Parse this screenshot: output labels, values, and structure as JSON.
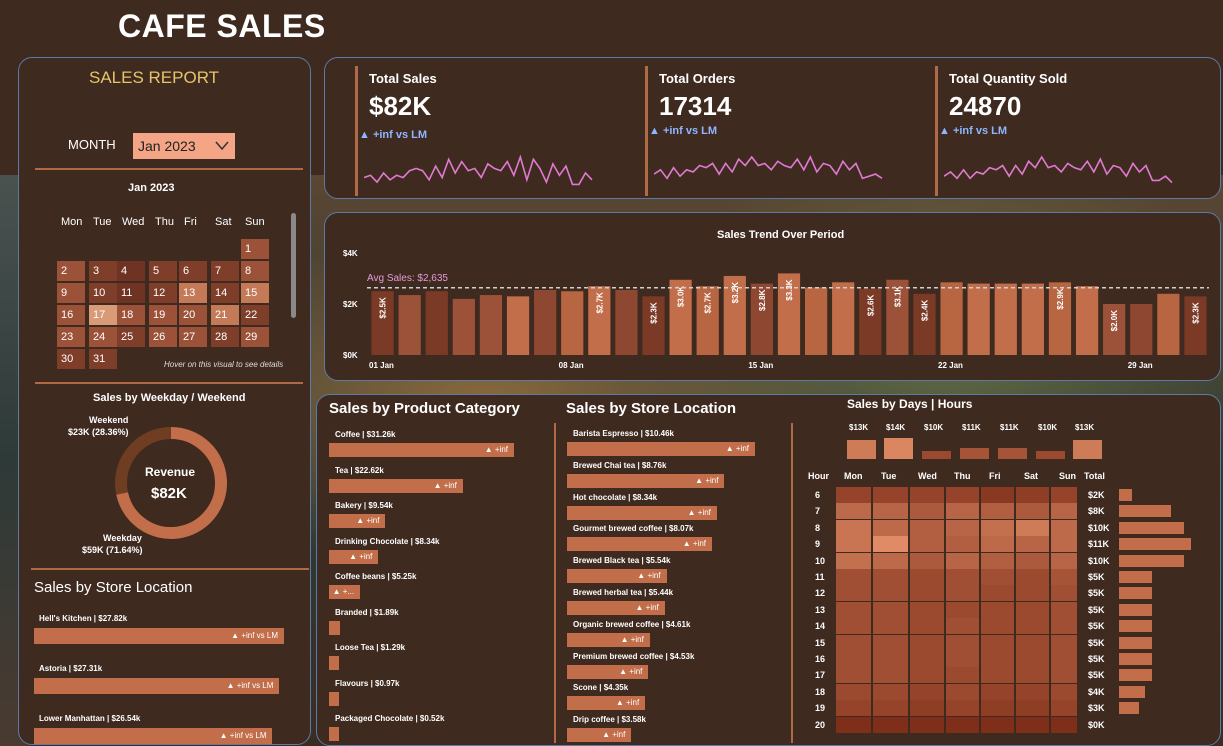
{
  "title": "CAFE SALES",
  "report": {
    "heading": "SALES REPORT",
    "month_label": "MONTH",
    "month_value": "Jan 2023",
    "calendar": {
      "title": "Jan 2023",
      "weekdays": [
        "Mon",
        "Tue",
        "Wed",
        "Thu",
        "Fri",
        "Sat",
        "Sun"
      ],
      "hint": "Hover on this visual to see details",
      "days": [
        {
          "d": "1",
          "col": 6,
          "row": 0,
          "c": "#9c5238"
        },
        {
          "d": "2",
          "col": 0,
          "row": 1,
          "c": "#9c5238"
        },
        {
          "d": "3",
          "col": 1,
          "row": 1,
          "c": "#7e3e29"
        },
        {
          "d": "4",
          "col": 2,
          "row": 1,
          "c": "#6e3322"
        },
        {
          "d": "5",
          "col": 3,
          "row": 1,
          "c": "#7e3e29"
        },
        {
          "d": "6",
          "col": 4,
          "row": 1,
          "c": "#7e3e29"
        },
        {
          "d": "7",
          "col": 5,
          "row": 1,
          "c": "#7e3e29"
        },
        {
          "d": "8",
          "col": 6,
          "row": 1,
          "c": "#9c5238"
        },
        {
          "d": "9",
          "col": 0,
          "row": 2,
          "c": "#9c5238"
        },
        {
          "d": "10",
          "col": 1,
          "row": 2,
          "c": "#7e3e29"
        },
        {
          "d": "11",
          "col": 2,
          "row": 2,
          "c": "#6e3322"
        },
        {
          "d": "12",
          "col": 3,
          "row": 2,
          "c": "#7e3e29"
        },
        {
          "d": "13",
          "col": 4,
          "row": 2,
          "c": "#c47a57"
        },
        {
          "d": "14",
          "col": 5,
          "row": 2,
          "c": "#7e3e29"
        },
        {
          "d": "15",
          "col": 6,
          "row": 2,
          "c": "#c47a57"
        },
        {
          "d": "16",
          "col": 0,
          "row": 3,
          "c": "#9c5238"
        },
        {
          "d": "17",
          "col": 1,
          "row": 3,
          "c": "#d99a78"
        },
        {
          "d": "18",
          "col": 2,
          "row": 3,
          "c": "#9c5238"
        },
        {
          "d": "19",
          "col": 3,
          "row": 3,
          "c": "#9c5238"
        },
        {
          "d": "20",
          "col": 4,
          "row": 3,
          "c": "#9c5238"
        },
        {
          "d": "21",
          "col": 5,
          "row": 3,
          "c": "#c47a57"
        },
        {
          "d": "22",
          "col": 6,
          "row": 3,
          "c": "#7e3e29"
        },
        {
          "d": "23",
          "col": 0,
          "row": 4,
          "c": "#9c5238"
        },
        {
          "d": "24",
          "col": 1,
          "row": 4,
          "c": "#9c5238"
        },
        {
          "d": "25",
          "col": 2,
          "row": 4,
          "c": "#7e3e29"
        },
        {
          "d": "26",
          "col": 3,
          "row": 4,
          "c": "#9c5238"
        },
        {
          "d": "27",
          "col": 4,
          "row": 4,
          "c": "#9c5238"
        },
        {
          "d": "28",
          "col": 5,
          "row": 4,
          "c": "#7e3e29"
        },
        {
          "d": "29",
          "col": 6,
          "row": 4,
          "c": "#9c5238"
        },
        {
          "d": "30",
          "col": 0,
          "row": 5,
          "c": "#7e3e29"
        },
        {
          "d": "31",
          "col": 1,
          "row": 5,
          "c": "#7e3e29"
        }
      ]
    }
  },
  "kpis": [
    {
      "label": "Total Sales",
      "value": "$82K",
      "delta": "▲ +inf vs LM",
      "spark": [
        5,
        6,
        3,
        7,
        4,
        6,
        5,
        8,
        9,
        8,
        4,
        10,
        5,
        13,
        7,
        12,
        8,
        9,
        5,
        11,
        9,
        8,
        12,
        6,
        14,
        4,
        13,
        9,
        3,
        11,
        6,
        10,
        2,
        2,
        7,
        4
      ]
    },
    {
      "label": "Total Orders",
      "value": "17314",
      "delta": "▲ +inf vs LM",
      "spark": [
        7,
        9,
        5,
        10,
        6,
        9,
        8,
        11,
        10,
        12,
        7,
        12,
        8,
        14,
        11,
        15,
        11,
        12,
        9,
        13,
        11,
        10,
        14,
        9,
        15,
        8,
        12,
        11,
        7,
        13,
        9,
        12,
        5,
        6,
        7,
        5
      ]
    },
    {
      "label": "Total Quantity Sold",
      "value": "24870",
      "delta": "▲ +inf vs LM",
      "spark": [
        6,
        8,
        5,
        9,
        5,
        8,
        7,
        10,
        9,
        11,
        6,
        11,
        7,
        13,
        10,
        15,
        10,
        11,
        8,
        12,
        10,
        9,
        13,
        8,
        14,
        7,
        11,
        10,
        6,
        12,
        8,
        11,
        4,
        4,
        6,
        3
      ]
    }
  ],
  "trend": {
    "title": "Sales Trend Over Period",
    "avg_label": "Avg Sales: $2,635",
    "avg": 2635,
    "ymax": 4000,
    "yticks": [
      "$0K",
      "$2K",
      "$4K"
    ],
    "xticks": [
      {
        "label": "01 Jan",
        "i": 0
      },
      {
        "label": "08 Jan",
        "i": 7
      },
      {
        "label": "15 Jan",
        "i": 14
      },
      {
        "label": "22 Jan",
        "i": 21
      },
      {
        "label": "29 Jan",
        "i": 28
      }
    ],
    "chart_data": {
      "type": "bar",
      "x": [
        "1",
        "2",
        "3",
        "4",
        "5",
        "6",
        "7",
        "8",
        "9",
        "10",
        "11",
        "12",
        "13",
        "14",
        "15",
        "16",
        "17",
        "18",
        "19",
        "20",
        "21",
        "22",
        "23",
        "24",
        "25",
        "26",
        "27",
        "28",
        "29",
        "30",
        "31"
      ],
      "values": [
        2500,
        2350,
        2500,
        2200,
        2350,
        2300,
        2550,
        2500,
        2700,
        2550,
        2300,
        2950,
        2700,
        3100,
        2800,
        3200,
        2650,
        2850,
        2600,
        2950,
        2400,
        2850,
        2800,
        2800,
        2800,
        2850,
        2700,
        2000,
        2000,
        2400,
        2300
      ],
      "labels": {
        "0": "$2.5K",
        "8": "$2.7K",
        "10": "$2.3K",
        "11": "$3.0K",
        "12": "$2.7K",
        "13": "$3.2K",
        "14": "$2.8K",
        "15": "$3.3K",
        "18": "$2.6K",
        "19": "$3.1K",
        "20": "$2.4K",
        "25": "$2.9K",
        "27": "$2.0K",
        "30": "$2.3K"
      },
      "title": "Sales Trend Over Period"
    }
  },
  "weekday": {
    "title": "Sales by Weekday / Weekend",
    "weekend_label": "Weekend",
    "weekend_value": "$23K (28.36%)",
    "weekday_label": "Weekday",
    "weekday_value": "$59K (71.64%)",
    "center_label": "Revenue",
    "center_value": "$82K",
    "chart_data": {
      "type": "pie",
      "categories": [
        "Weekend",
        "Weekday"
      ],
      "values": [
        28.36,
        71.64
      ]
    }
  },
  "store_left": {
    "title": "Sales by Store Location",
    "items": [
      {
        "label": "Hell's Kitchen | $27.82k",
        "value": 27.82,
        "tag": "▲ +inf vs LM"
      },
      {
        "label": "Astoria | $27.31k",
        "value": 27.31,
        "tag": "▲ +inf vs LM"
      },
      {
        "label": "Lower Manhattan | $26.54k",
        "value": 26.54,
        "tag": "▲ +inf vs LM"
      }
    ]
  },
  "category": {
    "title": "Sales by Product Category",
    "items": [
      {
        "label": "Coffee | $31.26k",
        "value": 31.26,
        "tag": "▲ +inf"
      },
      {
        "label": "Tea | $22.62k",
        "value": 22.62,
        "tag": "▲ +inf"
      },
      {
        "label": "Bakery | $9.54k",
        "value": 9.54,
        "tag": "▲ +inf"
      },
      {
        "label": "Drinking Chocolate | $8.34k",
        "value": 8.34,
        "tag": "▲ +inf"
      },
      {
        "label": "Coffee beans | $5.25k",
        "value": 5.25,
        "tag": "▲ +..."
      },
      {
        "label": "Branded | $1.89k",
        "value": 1.89,
        "tag": ""
      },
      {
        "label": "Loose Tea | $1.29k",
        "value": 1.29,
        "tag": ""
      },
      {
        "label": "Flavours | $0.97k",
        "value": 0.97,
        "tag": ""
      },
      {
        "label": "Packaged Chocolate | $0.52k",
        "value": 0.52,
        "tag": ""
      }
    ]
  },
  "store_products": {
    "title": "Sales by Store Location",
    "items": [
      {
        "label": "Barista Espresso | $10.46k",
        "value": 10.46,
        "tag": "▲ +inf"
      },
      {
        "label": "Brewed Chai tea | $8.76k",
        "value": 8.76,
        "tag": "▲ +inf"
      },
      {
        "label": "Hot chocolate | $8.34k",
        "value": 8.34,
        "tag": "▲ +inf"
      },
      {
        "label": "Gourmet brewed coffee | $8.07k",
        "value": 8.07,
        "tag": "▲ +inf"
      },
      {
        "label": "Brewed Black tea | $5.54k",
        "value": 5.54,
        "tag": "▲ +inf"
      },
      {
        "label": "Brewed herbal tea | $5.44k",
        "value": 5.44,
        "tag": "▲ +inf"
      },
      {
        "label": "Organic brewed coffee | $4.61k",
        "value": 4.61,
        "tag": "▲ +inf"
      },
      {
        "label": "Premium brewed coffee | $4.53k",
        "value": 4.53,
        "tag": "▲ +inf"
      },
      {
        "label": "Scone | $4.35k",
        "value": 4.35,
        "tag": "▲ +inf"
      },
      {
        "label": "Drip coffee | $3.58k",
        "value": 3.58,
        "tag": "▲ +inf"
      }
    ]
  },
  "heatmap": {
    "title": "Sales by Days | Hours",
    "day_totals": [
      "$13K",
      "$14K",
      "$10K",
      "$11K",
      "$11K",
      "$10K",
      "$13K"
    ],
    "day_levels": [
      0.75,
      0.85,
      0.3,
      0.4,
      0.4,
      0.3,
      0.75
    ],
    "hour_header": "Hour",
    "total_header": "Total",
    "days": [
      "Mon",
      "Tue",
      "Wed",
      "Thu",
      "Fri",
      "Sat",
      "Sun"
    ],
    "hours": [
      "6",
      "7",
      "8",
      "9",
      "10",
      "11",
      "12",
      "13",
      "14",
      "15",
      "16",
      "17",
      "18",
      "19",
      "20"
    ],
    "hour_totals": [
      "$2K",
      "$8K",
      "$10K",
      "$11K",
      "$10K",
      "$5K",
      "$5K",
      "$5K",
      "$5K",
      "$5K",
      "$5K",
      "$5K",
      "$4K",
      "$3K",
      "$0K"
    ],
    "hour_values": [
      2,
      8,
      10,
      11,
      10,
      5,
      5,
      5,
      5,
      5,
      5,
      5,
      4,
      3,
      0
    ],
    "grid": [
      [
        0.25,
        0.25,
        0.25,
        0.25,
        0.15,
        0.2,
        0.25
      ],
      [
        0.6,
        0.55,
        0.45,
        0.55,
        0.5,
        0.45,
        0.55
      ],
      [
        0.7,
        0.6,
        0.5,
        0.55,
        0.65,
        0.75,
        0.6
      ],
      [
        0.7,
        0.9,
        0.5,
        0.5,
        0.6,
        0.55,
        0.6
      ],
      [
        0.65,
        0.6,
        0.45,
        0.55,
        0.5,
        0.45,
        0.55
      ],
      [
        0.35,
        0.35,
        0.3,
        0.35,
        0.35,
        0.3,
        0.4
      ],
      [
        0.35,
        0.35,
        0.3,
        0.35,
        0.3,
        0.3,
        0.35
      ],
      [
        0.35,
        0.35,
        0.3,
        0.3,
        0.3,
        0.3,
        0.35
      ],
      [
        0.35,
        0.35,
        0.3,
        0.35,
        0.3,
        0.3,
        0.35
      ],
      [
        0.35,
        0.35,
        0.3,
        0.35,
        0.3,
        0.3,
        0.35
      ],
      [
        0.35,
        0.35,
        0.3,
        0.35,
        0.3,
        0.3,
        0.35
      ],
      [
        0.35,
        0.35,
        0.3,
        0.3,
        0.3,
        0.3,
        0.35
      ],
      [
        0.3,
        0.3,
        0.25,
        0.3,
        0.25,
        0.25,
        0.3
      ],
      [
        0.25,
        0.25,
        0.2,
        0.25,
        0.2,
        0.2,
        0.25
      ],
      [
        0.05,
        0.05,
        0.05,
        0.05,
        0.05,
        0.05,
        0.05
      ]
    ]
  },
  "colors": {
    "bg": "#3f2a20",
    "bar": "#c26e4a",
    "border": "#5b7aa6",
    "accent_text": "#e6c46a",
    "avg_line": "#e59bd6",
    "spark": "#e07ad0",
    "delta": "#8fb6ff"
  }
}
